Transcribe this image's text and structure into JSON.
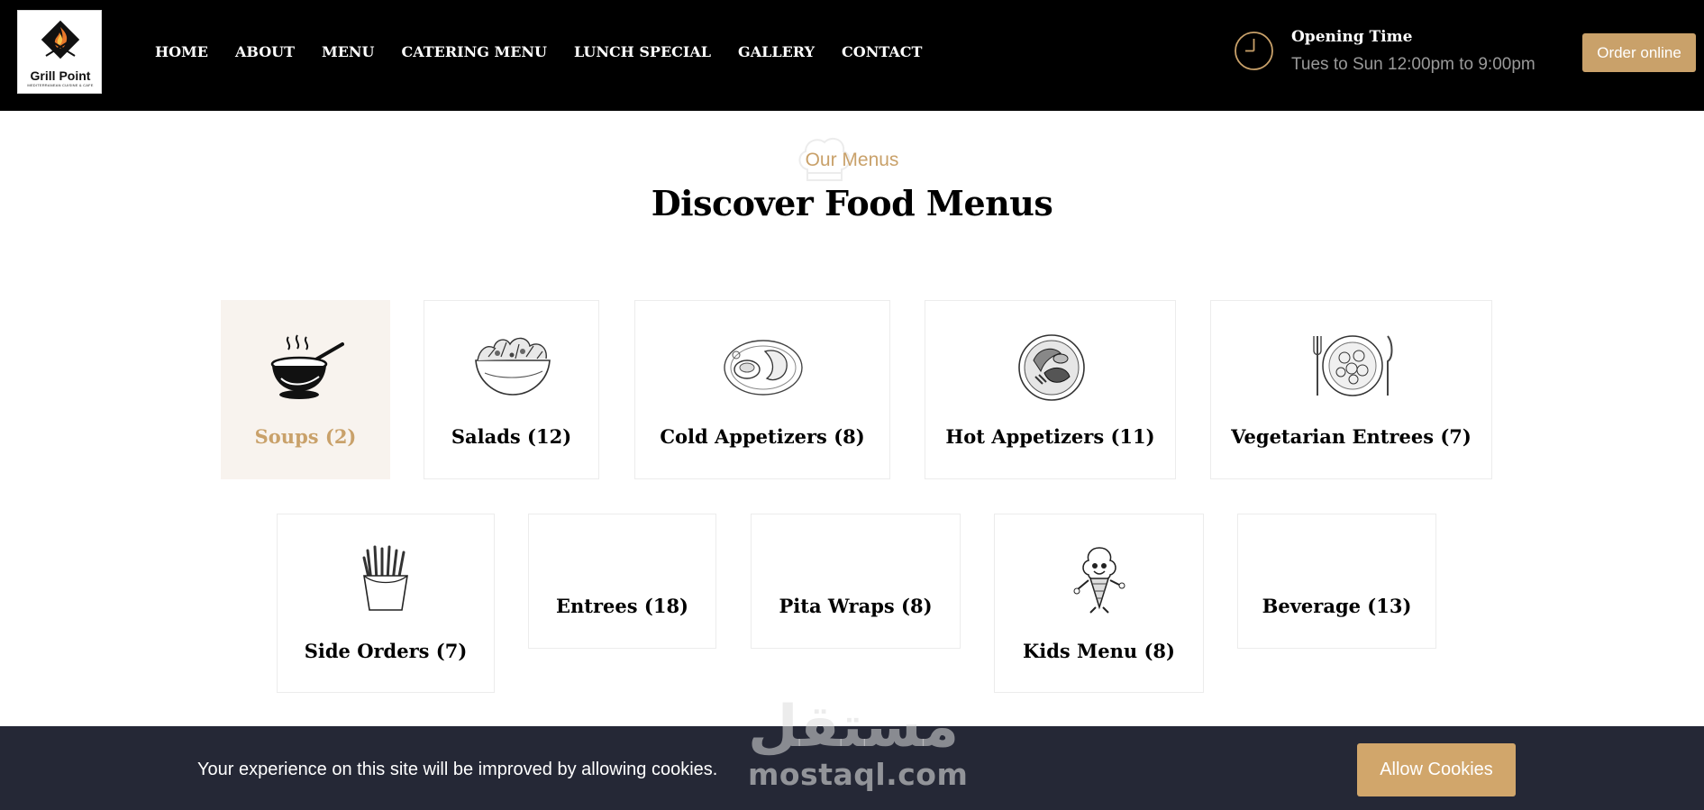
{
  "header": {
    "logo_name": "Grill Point",
    "logo_tagline": "MEDITERRANEAN CUISINE & CAFE",
    "nav": [
      {
        "label": "HOME"
      },
      {
        "label": "ABOUT"
      },
      {
        "label": "MENU"
      },
      {
        "label": "CATERING MENU"
      },
      {
        "label": "LUNCH SPECIAL"
      },
      {
        "label": "GALLERY"
      },
      {
        "label": "CONTACT"
      }
    ],
    "opening_title": "Opening Time",
    "opening_hours": "Tues to Sun 12:00pm to 9:00pm",
    "order_label": "Order online"
  },
  "section": {
    "eyebrow": "Our Menus",
    "title": "Discover Food Menus"
  },
  "categories": [
    {
      "label": "Soups (2)",
      "icon": "soup-bowl-icon",
      "active": true
    },
    {
      "label": "Salads (12)",
      "icon": "salad-bowl-icon",
      "active": false
    },
    {
      "label": "Cold Appetizers (8)",
      "icon": "cold-appetizer-plate-icon",
      "active": false
    },
    {
      "label": "Hot Appetizers (11)",
      "icon": "hot-appetizer-plate-icon",
      "active": false
    },
    {
      "label": "Vegetarian Entrees (7)",
      "icon": "vegetarian-plate-icon",
      "active": false
    },
    {
      "label": "Side Orders (7)",
      "icon": "fries-icon",
      "active": false
    },
    {
      "label": "Entrees (18)",
      "icon": "",
      "active": false
    },
    {
      "label": "Pita Wraps (8)",
      "icon": "",
      "active": false
    },
    {
      "label": "Kids Menu (8)",
      "icon": "ice-cream-mascot-icon",
      "active": false
    },
    {
      "label": "Beverage (13)",
      "icon": "",
      "active": false
    }
  ],
  "cookie": {
    "text": "Your experience on this site will be improved by allowing cookies.",
    "button": "Allow Cookies"
  },
  "watermark": {
    "arabic": "مستقل",
    "latin": "mostaql.com"
  },
  "colors": {
    "accent": "#c9a16a",
    "header_bg": "#000000",
    "cookie_bg": "#252836",
    "active_card_bg": "#f8f3ee"
  }
}
